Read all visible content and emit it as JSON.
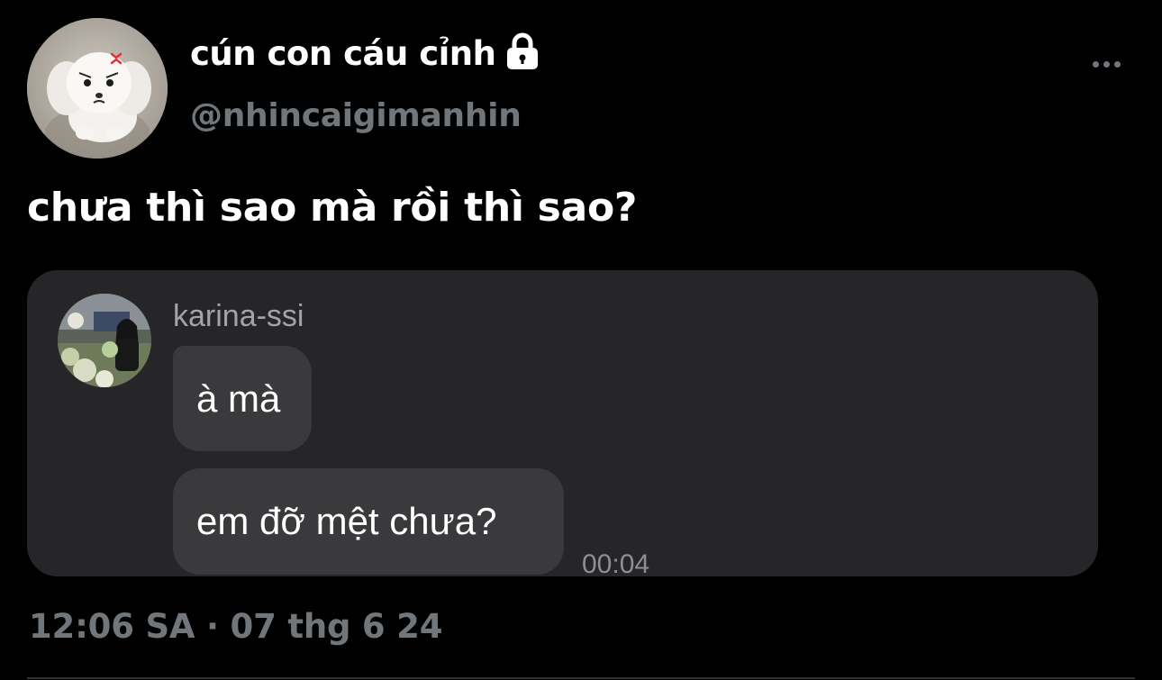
{
  "author": {
    "display_name": "cún con cáu cỉnh",
    "handle": "@nhincaigimanhin",
    "protected_icon": "lock-icon",
    "avatar_icon": "white-puppy-avatar"
  },
  "menu": {
    "icon": "more-dots-icon"
  },
  "tweet": {
    "text": "chưa thì sao mà rồi thì sao?",
    "timestamp": "12:06 SA · 07 thg 6 24"
  },
  "chat_screenshot": {
    "sender": "karina-ssi",
    "messages": [
      {
        "text": "à mà"
      },
      {
        "text": "em đỡ mệt chưa?"
      }
    ],
    "time": "00:04"
  },
  "colors": {
    "background": "#000000",
    "secondary_text": "#71767b",
    "card_background": "#262628",
    "bubble_background": "#3a3a3c"
  }
}
